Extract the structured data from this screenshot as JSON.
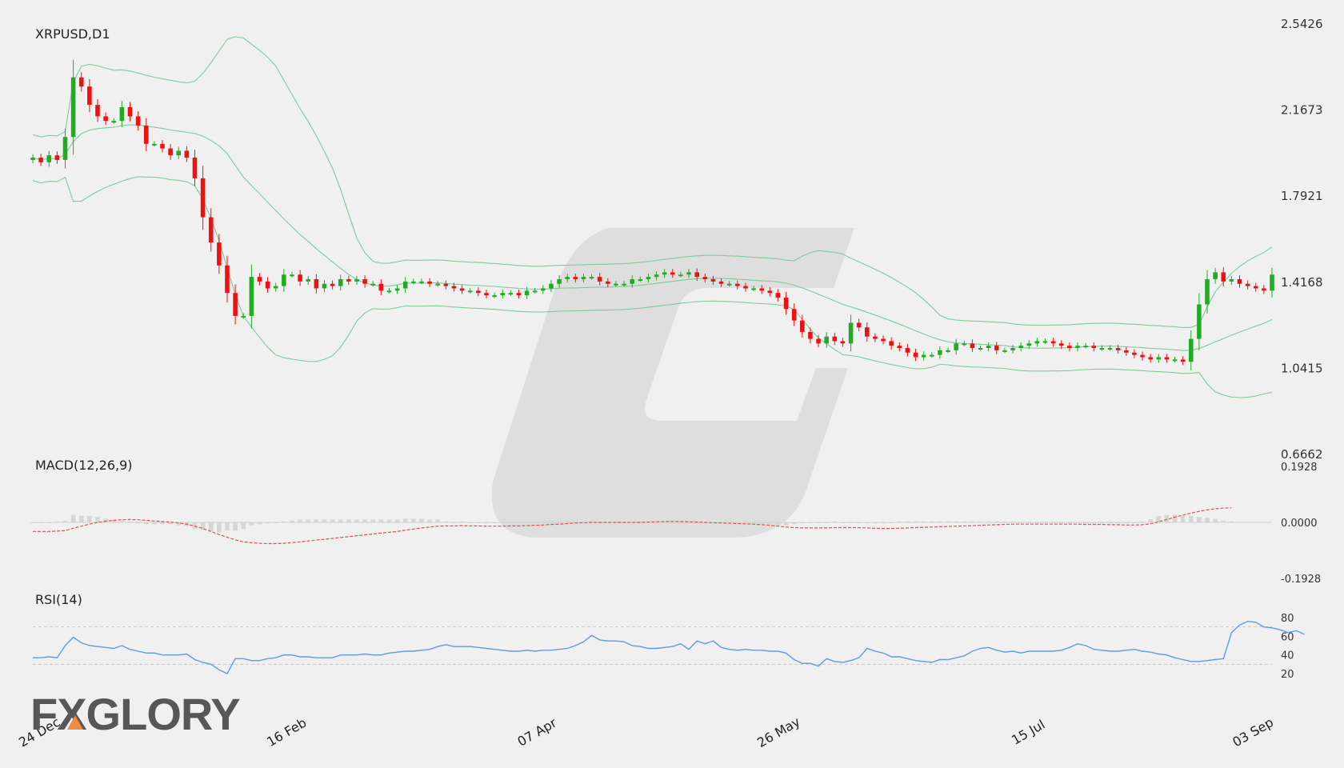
{
  "chart_data": {
    "type": "candlestick",
    "title": "XRPUSD,D1",
    "price_axis": {
      "ticks": [
        "2.5426",
        "2.1673",
        "1.7921",
        "1.4168",
        "1.0415",
        "0.6662"
      ],
      "ylim": [
        0.6662,
        2.5426
      ]
    },
    "x_axis": {
      "tick_labels": [
        "24 Dec",
        "16 Feb",
        "07 Apr",
        "26 May",
        "15 Jul",
        "03 Sep"
      ]
    },
    "indicators": {
      "bollinger": {
        "color": "#7fc99a"
      },
      "macd": {
        "label": "MACD(12,26,9)",
        "ticks": [
          "0.1928",
          "0.0000",
          "-0.1928"
        ],
        "ylim": [
          -0.1928,
          0.1928
        ],
        "signal_color": "#e05050",
        "hist_color": "#d6d6d6"
      },
      "rsi": {
        "label": "RSI(14)",
        "ticks": [
          "80",
          "60",
          "40",
          "20"
        ],
        "levels": [
          70,
          30
        ],
        "line_color": "#5c9be6"
      }
    },
    "colors": {
      "up": "#22aa22",
      "down": "#ee1111"
    },
    "price": [
      1.96,
      1.94,
      1.97,
      1.95,
      2.05,
      2.31,
      2.27,
      2.19,
      2.14,
      2.12,
      2.12,
      2.18,
      2.14,
      2.1,
      2.02,
      2.02,
      2.0,
      1.97,
      1.99,
      1.96,
      1.87,
      1.7,
      1.59,
      1.49,
      1.37,
      1.27,
      1.27,
      1.44,
      1.42,
      1.39,
      1.4,
      1.45,
      1.45,
      1.42,
      1.43,
      1.39,
      1.41,
      1.4,
      1.43,
      1.42,
      1.43,
      1.41,
      1.41,
      1.38,
      1.38,
      1.39,
      1.42,
      1.42,
      1.42,
      1.41,
      1.41,
      1.4,
      1.39,
      1.38,
      1.38,
      1.37,
      1.36,
      1.36,
      1.37,
      1.37,
      1.36,
      1.38,
      1.38,
      1.39,
      1.41,
      1.43,
      1.44,
      1.43,
      1.44,
      1.44,
      1.42,
      1.41,
      1.41,
      1.41,
      1.43,
      1.43,
      1.44,
      1.45,
      1.46,
      1.45,
      1.45,
      1.46,
      1.44,
      1.43,
      1.42,
      1.41,
      1.41,
      1.4,
      1.39,
      1.39,
      1.38,
      1.37,
      1.35,
      1.3,
      1.25,
      1.2,
      1.17,
      1.15,
      1.18,
      1.16,
      1.15,
      1.24,
      1.22,
      1.18,
      1.17,
      1.16,
      1.14,
      1.13,
      1.11,
      1.09,
      1.1,
      1.1,
      1.12,
      1.12,
      1.15,
      1.15,
      1.13,
      1.13,
      1.14,
      1.12,
      1.12,
      1.13,
      1.14,
      1.15,
      1.16,
      1.16,
      1.15,
      1.14,
      1.13,
      1.14,
      1.14,
      1.13,
      1.13,
      1.13,
      1.12,
      1.11,
      1.1,
      1.09,
      1.08,
      1.09,
      1.08,
      1.08,
      1.07,
      1.17,
      1.32,
      1.43,
      1.46,
      1.42,
      1.43,
      1.41,
      1.4,
      1.39,
      1.38,
      1.45
    ],
    "rsi": [
      37,
      37,
      38,
      37,
      50,
      59,
      53,
      50,
      49,
      48,
      47,
      50,
      46,
      44,
      42,
      42,
      40,
      40,
      40,
      41,
      35,
      32,
      30,
      24,
      20,
      36,
      36,
      34,
      34,
      36,
      37,
      40,
      40,
      38,
      38,
      37,
      37,
      37,
      40,
      40,
      40,
      41,
      40,
      40,
      42,
      43,
      44,
      44,
      45,
      46,
      49,
      51,
      49,
      49,
      49,
      48,
      47,
      46,
      45,
      44,
      44,
      45,
      44,
      45,
      45,
      46,
      47,
      50,
      54,
      61,
      56,
      55,
      55,
      54,
      50,
      49,
      47,
      47,
      48,
      49,
      52,
      46,
      55,
      52,
      55,
      48,
      46,
      45,
      46,
      45,
      45,
      44,
      44,
      42,
      35,
      31,
      31,
      28,
      36,
      33,
      32,
      34,
      37,
      47,
      44,
      42,
      38,
      38,
      36,
      34,
      33,
      32,
      35,
      35,
      37,
      39,
      44,
      47,
      48,
      45,
      43,
      44,
      42,
      44,
      44,
      44,
      44,
      45,
      48,
      52,
      50,
      46,
      45,
      44,
      44,
      45,
      46,
      44,
      43,
      41,
      40,
      37,
      35,
      33,
      33,
      34,
      35,
      36,
      64,
      72,
      76,
      75,
      70,
      69,
      67,
      64,
      66,
      62
    ],
    "macd_signal": [
      -0.031,
      -0.031,
      -0.031,
      -0.03,
      -0.028,
      -0.02,
      -0.013,
      -0.006,
      0.0,
      0.004,
      0.007,
      0.009,
      0.01,
      0.009,
      0.007,
      0.005,
      0.003,
      0.001,
      -0.002,
      -0.006,
      -0.013,
      -0.021,
      -0.031,
      -0.042,
      -0.051,
      -0.06,
      -0.067,
      -0.07,
      -0.072,
      -0.073,
      -0.073,
      -0.072,
      -0.07,
      -0.067,
      -0.064,
      -0.061,
      -0.058,
      -0.055,
      -0.052,
      -0.049,
      -0.046,
      -0.043,
      -0.04,
      -0.037,
      -0.034,
      -0.031,
      -0.027,
      -0.023,
      -0.019,
      -0.016,
      -0.013,
      -0.012,
      -0.012,
      -0.011,
      -0.012,
      -0.012,
      -0.013,
      -0.013,
      -0.013,
      -0.012,
      -0.012,
      -0.011,
      -0.01,
      -0.009,
      -0.007,
      -0.006,
      -0.004,
      -0.002,
      -0.001,
      0.0,
      0.0,
      0.0,
      0.0,
      0.0,
      0.0,
      0.0,
      0.001,
      0.002,
      0.003,
      0.003,
      0.003,
      0.002,
      0.001,
      0.0,
      -0.001,
      -0.002,
      -0.003,
      -0.004,
      -0.005,
      -0.006,
      -0.008,
      -0.01,
      -0.013,
      -0.016,
      -0.018,
      -0.019,
      -0.019,
      -0.019,
      -0.019,
      -0.018,
      -0.018,
      -0.018,
      -0.018,
      -0.019,
      -0.02,
      -0.021,
      -0.021,
      -0.02,
      -0.019,
      -0.018,
      -0.017,
      -0.016,
      -0.015,
      -0.014,
      -0.013,
      -0.012,
      -0.011,
      -0.01,
      -0.009,
      -0.008,
      -0.007,
      -0.006,
      -0.006,
      -0.006,
      -0.006,
      -0.006,
      -0.006,
      -0.006,
      -0.006,
      -0.006,
      -0.007,
      -0.007,
      -0.007,
      -0.008,
      -0.008,
      -0.009,
      -0.009,
      -0.008,
      -0.005,
      0.002,
      0.01,
      0.018,
      0.025,
      0.032,
      0.038,
      0.043,
      0.047,
      0.049,
      0.05
    ]
  }
}
